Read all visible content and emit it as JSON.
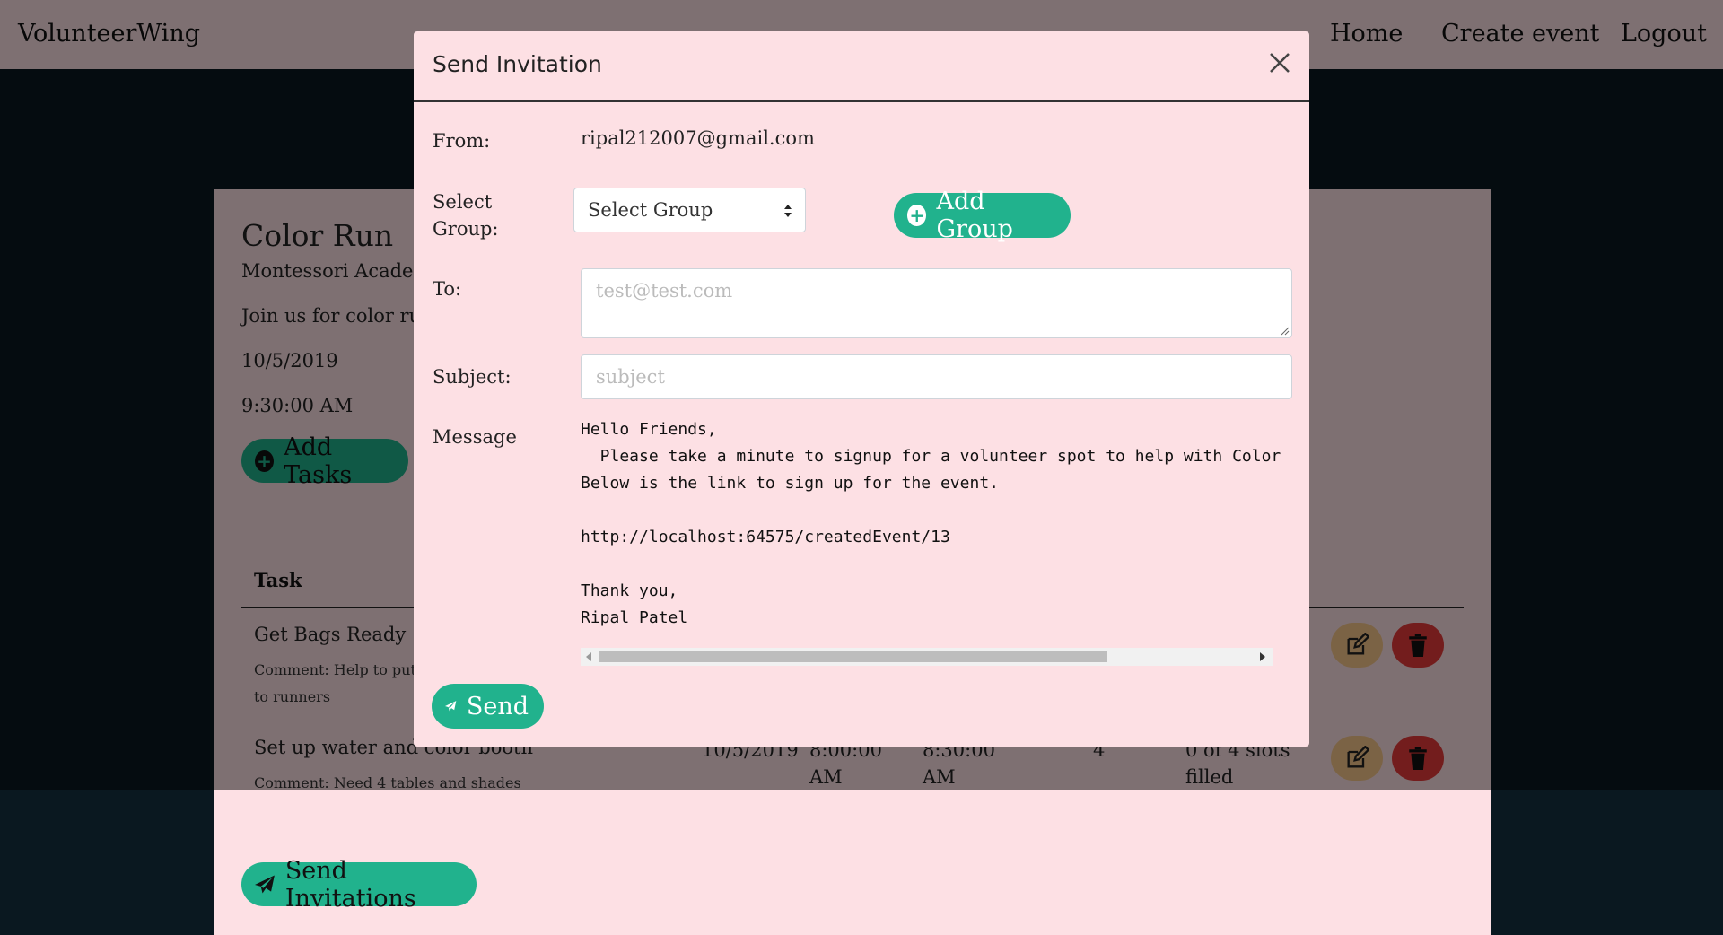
{
  "nav": {
    "brand": "VolunteerWing",
    "home": "Home",
    "create_event": "Create event",
    "logout": "Logout"
  },
  "event": {
    "title": "Color Run",
    "location": "Montessori Academ",
    "description": "Join us for color run",
    "date": "10/5/2019",
    "time": "9:30:00 AM",
    "add_tasks_label": "Add Tasks"
  },
  "tasks": {
    "header_task": "Task",
    "rows": [
      {
        "name": "Get Bags Ready",
        "comment_line1": "Comment: Help to put",
        "comment_line2": "to runners"
      },
      {
        "name": "Set up water and color booth",
        "comment_line1": "Comment: Need 4 tables and shades",
        "date": "10/5/2019",
        "start_1": "8:00:00",
        "start_2": "AM",
        "end_1": "8:30:00",
        "end_2": "AM",
        "slots": "4",
        "filled_1": "0 of 4 slots",
        "filled_2": "filled"
      }
    ]
  },
  "send_invitations_label": "Send Invitations",
  "modal": {
    "title": "Send Invitation",
    "from_label": "From:",
    "from_value": "ripal212007@gmail.com",
    "group_label_1": "Select",
    "group_label_2": "Group:",
    "group_select_value": "Select Group",
    "add_group_label": "Add Group",
    "to_label": "To:",
    "to_placeholder": "test@test.com",
    "subject_label": "Subject:",
    "subject_placeholder": "subject",
    "message_label": "Message",
    "message_lines": [
      "Hello Friends,",
      "  Please take a minute to signup for a volunteer spot to help with Color",
      "Below is the link to sign up for the event.",
      "",
      "http://localhost:64575/createdEvent/13",
      "",
      "Thank you,",
      "Ripal Patel"
    ],
    "send_label": "Send"
  },
  "colors": {
    "accent": "#21b28d",
    "nav_bg": "#fde0e4",
    "dark_bg": "#0a1820",
    "edit": "#f7c68a",
    "delete": "#e63a3a"
  },
  "icons": [
    "close-icon",
    "plus-circle-icon",
    "paper-plane-icon",
    "edit-icon",
    "trash-icon",
    "select-arrows-icon",
    "resize-handle-icon"
  ]
}
